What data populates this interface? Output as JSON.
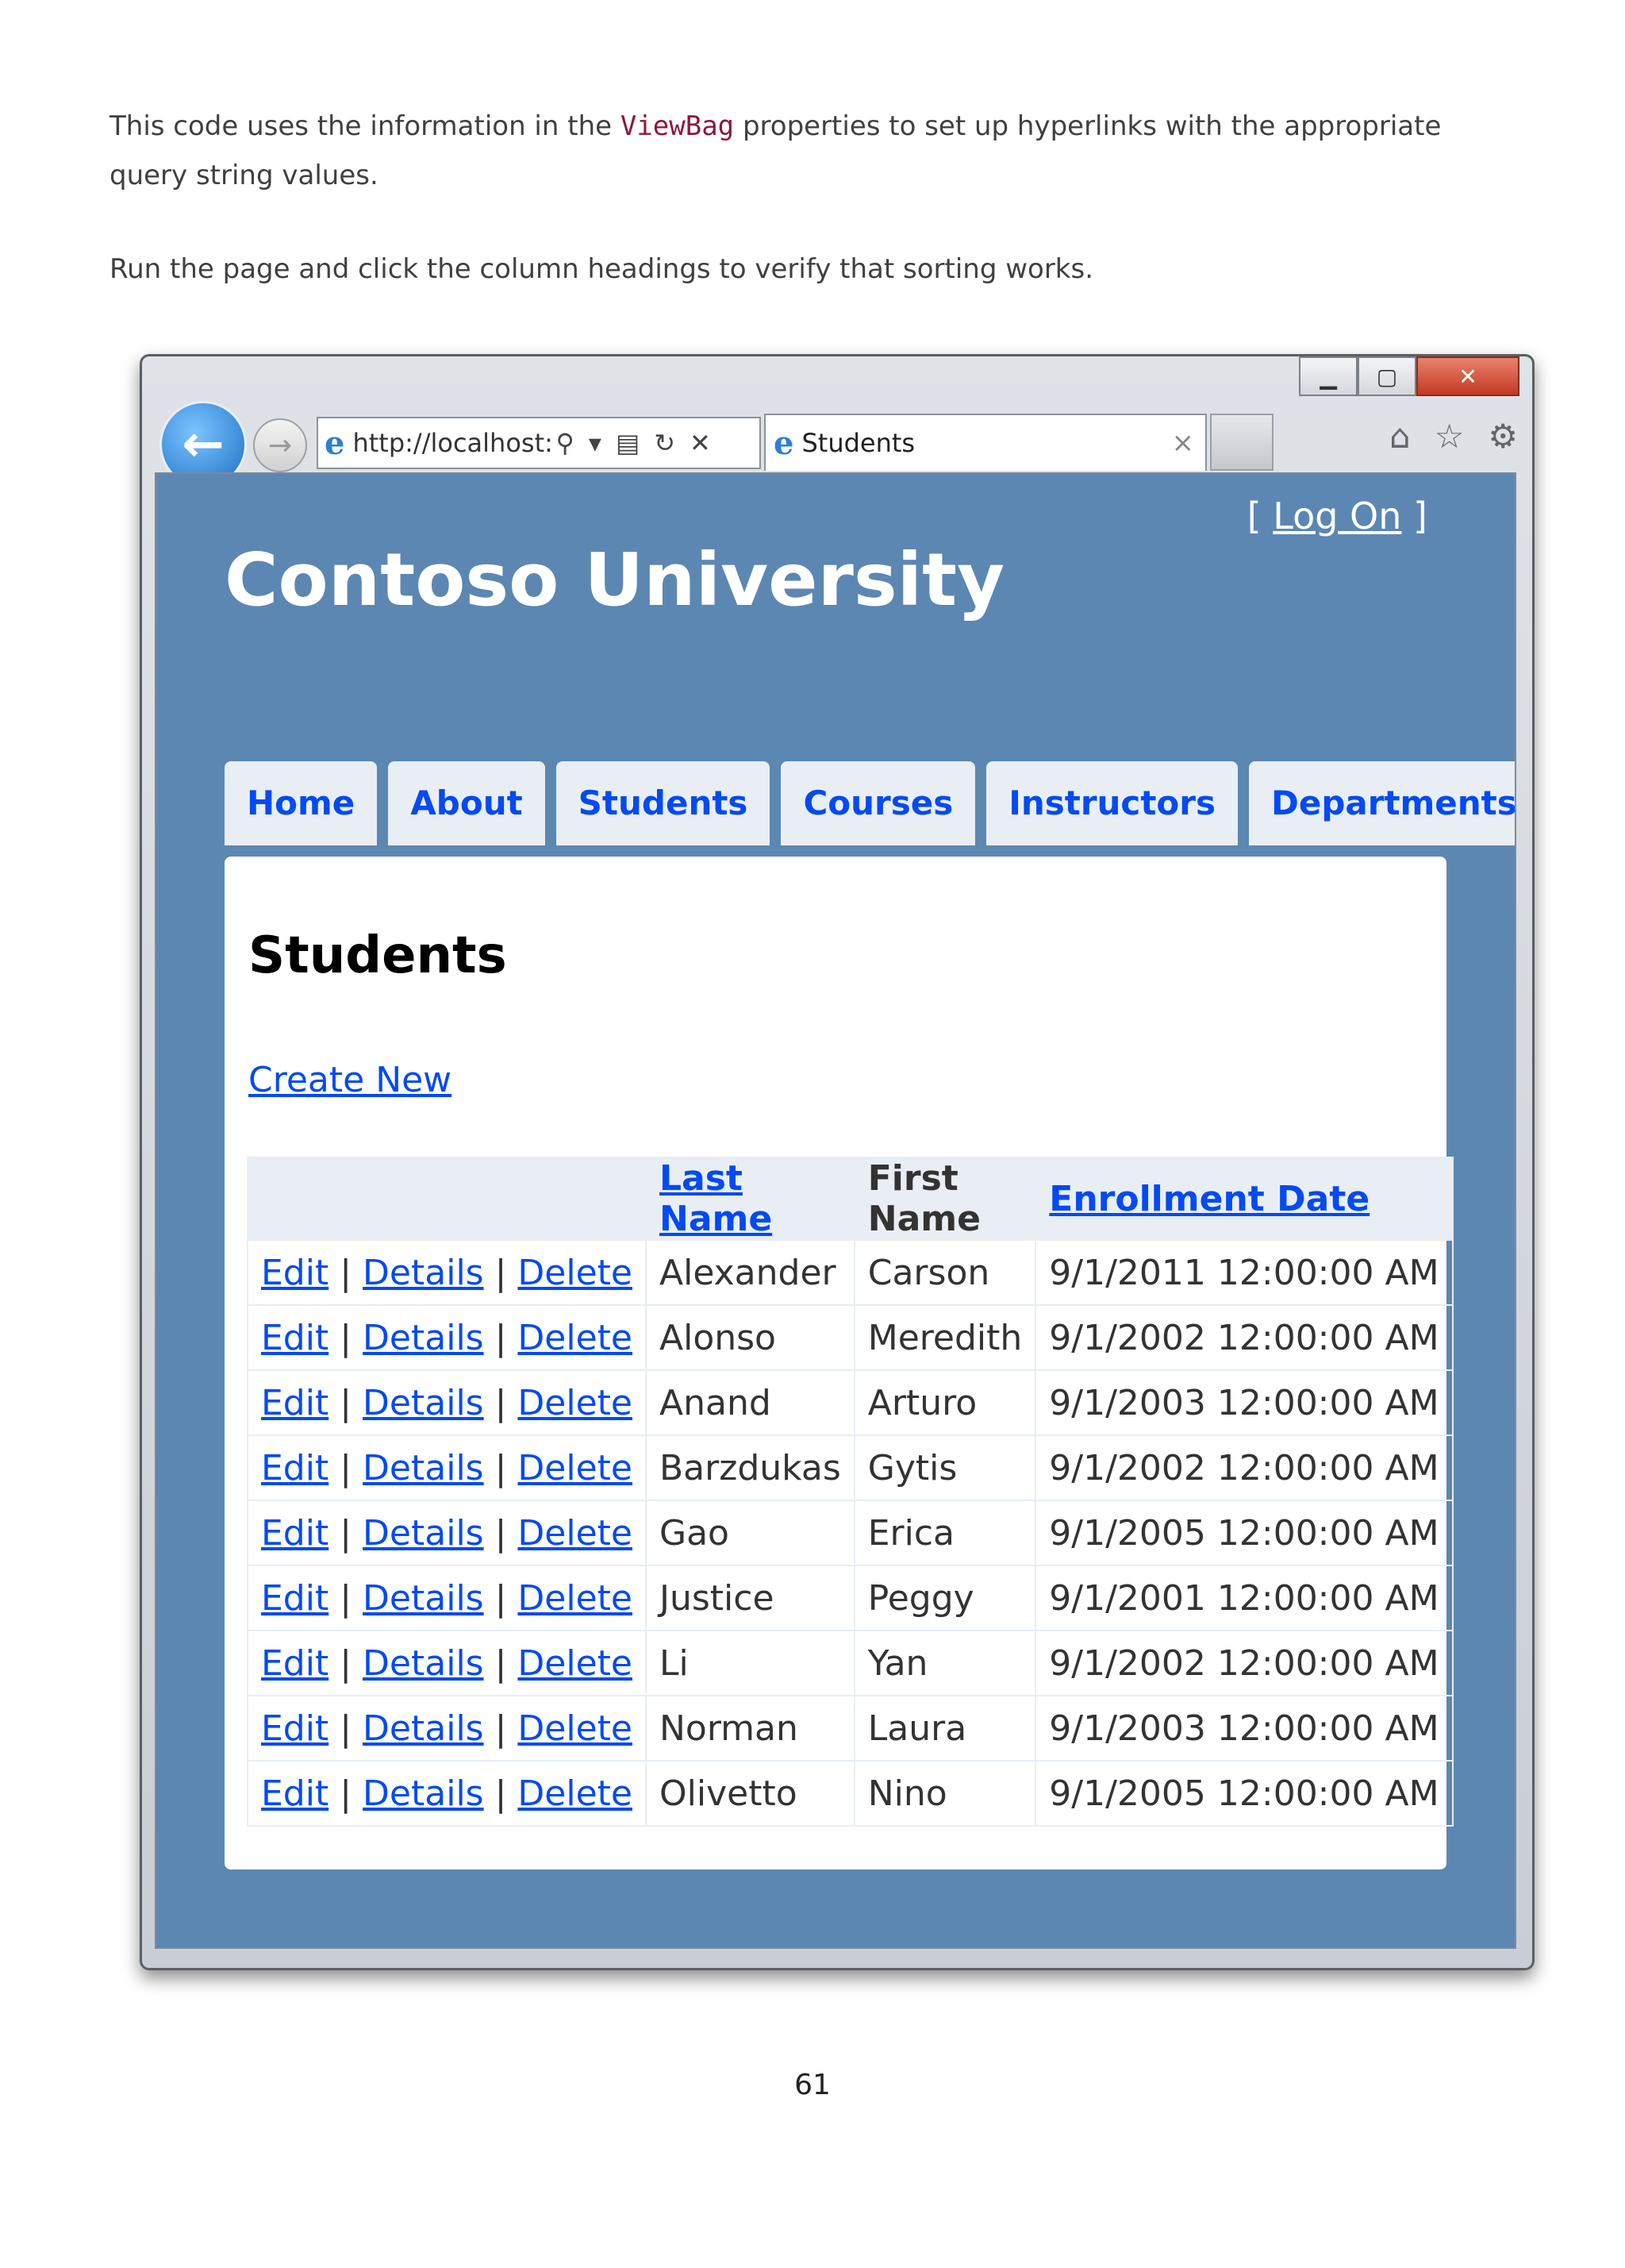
{
  "document": {
    "para1_before": "This code uses the information in the ",
    "para1_code": "ViewBag",
    "para1_after": " properties to set up hyperlinks with the appropriate query string values.",
    "para2": "Run the page and click the column headings to verify that sorting works.",
    "page_number": "61"
  },
  "browser": {
    "url": "http://localhost:",
    "tab_title": "Students"
  },
  "site": {
    "logon_open": "[ ",
    "logon_label": "Log On",
    "logon_close": " ]",
    "title": "Contoso University",
    "menu": [
      "Home",
      "About",
      "Students",
      "Courses",
      "Instructors",
      "Departments"
    ]
  },
  "page": {
    "heading": "Students",
    "create_new": "Create New",
    "action_labels": {
      "edit": "Edit",
      "details": "Details",
      "delete": "Delete",
      "separator": "|"
    },
    "columns": {
      "last_name": "Last Name",
      "first_name": "First Name",
      "enrollment_date": "Enrollment Date"
    },
    "rows": [
      {
        "last": "Alexander",
        "first": "Carson",
        "date": "9/1/2011 12:00:00 AM"
      },
      {
        "last": "Alonso",
        "first": "Meredith",
        "date": "9/1/2002 12:00:00 AM"
      },
      {
        "last": "Anand",
        "first": "Arturo",
        "date": "9/1/2003 12:00:00 AM"
      },
      {
        "last": "Barzdukas",
        "first": "Gytis",
        "date": "9/1/2002 12:00:00 AM"
      },
      {
        "last": "Gao",
        "first": "Erica",
        "date": "9/1/2005 12:00:00 AM"
      },
      {
        "last": "Justice",
        "first": "Peggy",
        "date": "9/1/2001 12:00:00 AM"
      },
      {
        "last": "Li",
        "first": "Yan",
        "date": "9/1/2002 12:00:00 AM"
      },
      {
        "last": "Norman",
        "first": "Laura",
        "date": "9/1/2003 12:00:00 AM"
      },
      {
        "last": "Olivetto",
        "first": "Nino",
        "date": "9/1/2005 12:00:00 AM"
      }
    ]
  },
  "colors": {
    "site_background": "#5c87b2",
    "link": "#034af3",
    "header_row": "#e8eef4",
    "code": "#8b1a3c"
  },
  "icons": [
    "back-arrow-icon",
    "forward-arrow-icon",
    "ie-logo-icon",
    "search-icon",
    "dropdown-icon",
    "compat-view-icon",
    "refresh-icon",
    "stop-icon",
    "tab-close-icon",
    "home-icon",
    "favorites-star-icon",
    "settings-gear-icon",
    "minimize-icon",
    "maximize-icon",
    "window-close-icon"
  ]
}
